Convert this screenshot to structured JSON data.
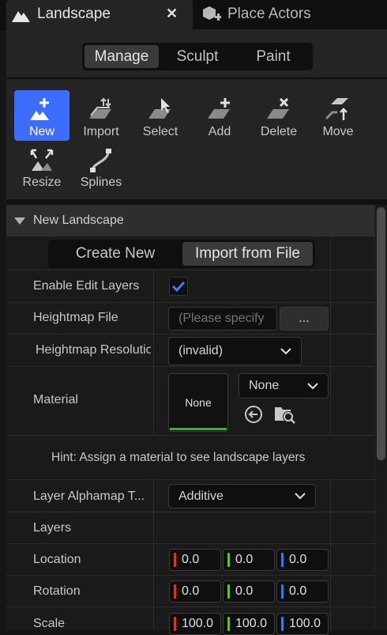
{
  "tabs": {
    "active_label": "Landscape",
    "inactive_label": "Place Actors"
  },
  "modes": [
    "Manage",
    "Sculpt",
    "Paint"
  ],
  "tools": {
    "new": "New",
    "import": "Import",
    "select": "Select",
    "add": "Add",
    "delete": "Delete",
    "move": "Move",
    "resize": "Resize",
    "splines": "Splines"
  },
  "details": {
    "section_title": "New Landscape",
    "create_new": "Create New",
    "import_from_file": "Import from File",
    "enable_edit_layers": "Enable Edit Layers",
    "enable_edit_layers_checked": true,
    "heightmap_file": "Heightmap File",
    "heightmap_file_placeholder": "(Please specify",
    "browse_label": "...",
    "heightmap_resolution": "Heightmap Resolutio",
    "heightmap_resolution_value": "(invalid)",
    "material": "Material",
    "material_thumb": "None",
    "material_combo": "None",
    "hint": "Hint: Assign a material to see landscape layers",
    "layer_alphamap": "Layer Alphamap T...",
    "layer_alphamap_value": "Additive",
    "layers": "Layers",
    "location": "Location",
    "location_values": [
      "0.0",
      "0.0",
      "0.0"
    ],
    "rotation": "Rotation",
    "rotation_values": [
      "0.0",
      "0.0",
      "0.0"
    ],
    "scale": "Scale",
    "scale_values": [
      "100.0",
      "100.0",
      "100.0"
    ]
  },
  "colors": {
    "accent": "#3d6dff",
    "axis_x": "#d9342b",
    "axis_y": "#6bbf2a",
    "axis_z": "#3a7be0",
    "thumb_underline": "#2eb82e"
  }
}
